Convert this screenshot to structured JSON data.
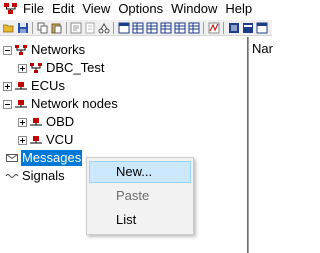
{
  "menubar": {
    "app_icon": "network-tree-icon",
    "items": [
      "File",
      "Edit",
      "View",
      "Options",
      "Window",
      "Help"
    ]
  },
  "toolbar": {
    "icons": [
      "open-folder-icon",
      "save-icon",
      "copy-icon",
      "paste-icon",
      "properties-icon",
      "cut-icon",
      "network-icon",
      "table-icon",
      "grid-icon",
      "grid-icon",
      "grid-icon",
      "grid-icon",
      "grid-icon",
      "signal-icon",
      "list-icon",
      "list-icon",
      "list-icon"
    ]
  },
  "tree": {
    "networks": "Networks",
    "dbc_test": "DBC_Test",
    "ecus": "ECUs",
    "network_nodes": "Network nodes",
    "obd": "OBD",
    "vcu": "VCU",
    "messages": "Messages",
    "signals": "Signals"
  },
  "right_pane": {
    "column_header": "Nar"
  },
  "context_menu": {
    "new": "New...",
    "paste": "Paste",
    "list": "List"
  },
  "colors": {
    "selection": "#0078d7",
    "menu_hover": "#cce8ff",
    "network_icon_red": "#c00000",
    "disabled_text": "#6d6d6d"
  }
}
